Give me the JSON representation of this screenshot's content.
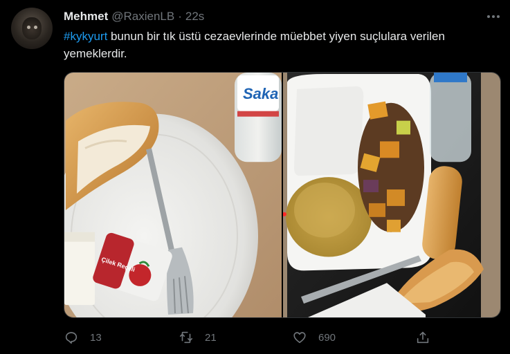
{
  "tweet": {
    "author_name": "Mehmet",
    "author_handle": "@RaxienLB",
    "separator": "·",
    "time": "22s",
    "hashtag": "#kykyurt",
    "text": " bunun bir tık üstü cezaevlerinde müebbet yiyen suçlulara verilen yemeklerdir.",
    "photo_left_label": "Saka",
    "photo_left_jam_label": "Çilek Reçeli",
    "actions": {
      "reply_count": "13",
      "retweet_count": "21",
      "like_count": "690"
    }
  },
  "colors": {
    "background": "#000000",
    "text": "#e7e9ea",
    "muted": "#71767b",
    "accent": "#1d9bf0"
  },
  "icons": [
    "more-icon",
    "reply-icon",
    "retweet-icon",
    "like-icon",
    "share-icon"
  ]
}
